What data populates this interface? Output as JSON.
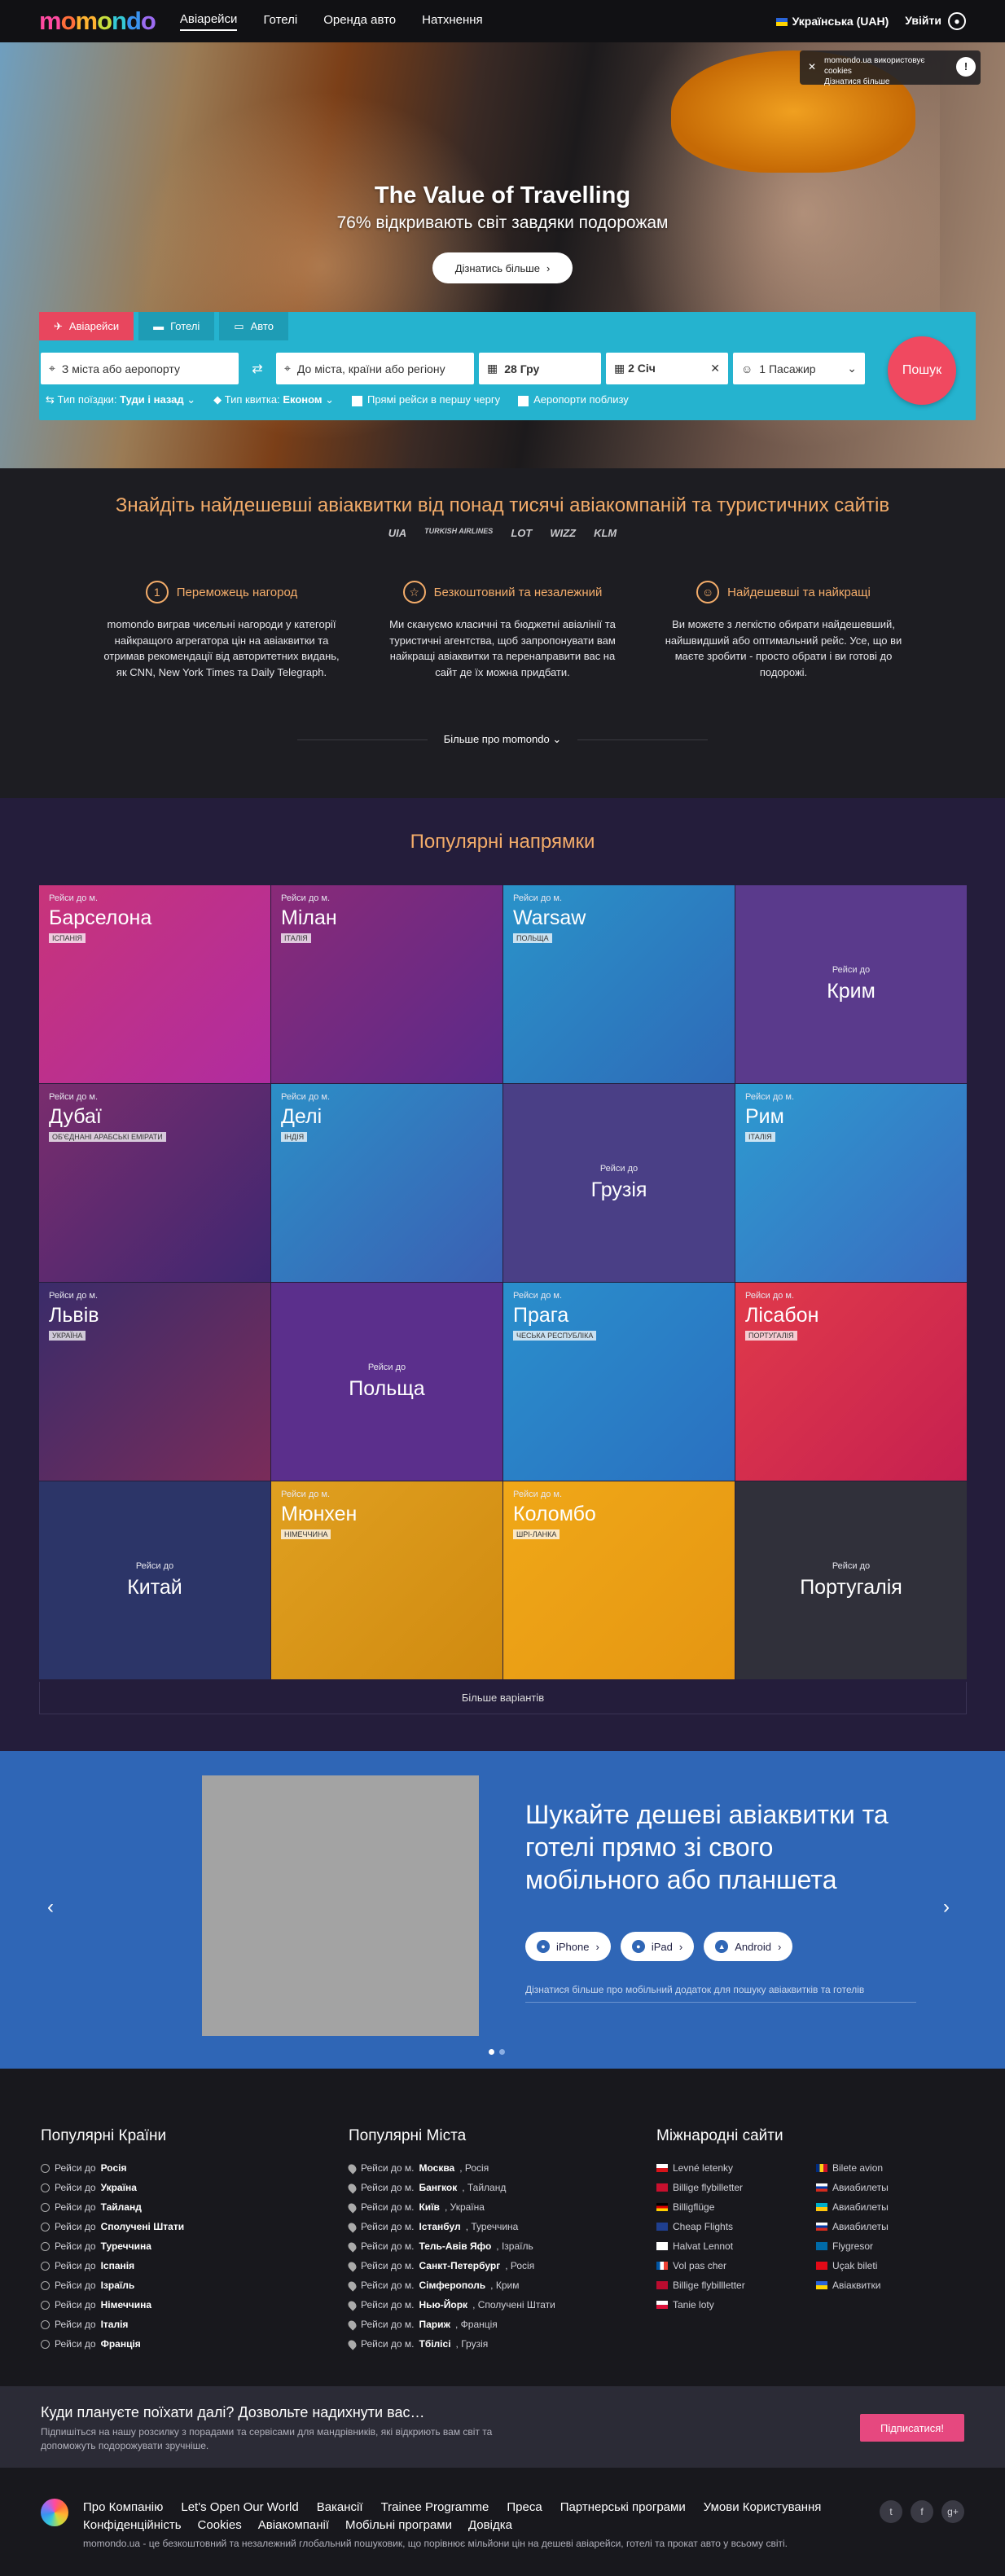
{
  "nav": {
    "logo": "momondo",
    "logo_letters": [
      "m",
      "o",
      "m",
      "o",
      "n",
      "d",
      "o"
    ],
    "links": [
      "Авіарейси",
      "Готелі",
      "Оренда авто",
      "Натхнення"
    ],
    "language": "Українська (UAH)",
    "login": "Увійти"
  },
  "hero": {
    "title": "The Value of Travelling",
    "subtitle": "76% відкривають світ завдяки подорожам",
    "button": "Дізнатись більше"
  },
  "cookie": {
    "text": "momondo.ua використовує cookies",
    "link": "Дізнатися більше"
  },
  "search": {
    "tabs": [
      "Авіарейси",
      "Готелі",
      "Авто"
    ],
    "from_placeholder": "З міста або аеропорту",
    "to_placeholder": "До міста, країни або регіону",
    "depart": "28 Гру",
    "return": "2 Січ",
    "passengers": "1 Пасажир",
    "button": "Пошук",
    "trip_type_label": "Тип поїздки:",
    "trip_type_value": "Туди і назад",
    "ticket_type_label": "Тип квитка:",
    "ticket_type_value": "Економ",
    "direct_first": "Прямі рейси в першу чергу",
    "nearby_airports": "Аеропорти поблизу"
  },
  "find": {
    "title": "Знайдіть найдешевші авіаквитки від понад тисячі авіакомпаній та туристичних сайтів",
    "airlines": [
      "UIA",
      "TURKISH AIRLINES",
      "LOT",
      "WIZZ",
      "KLM"
    ],
    "features": [
      {
        "title": "Переможець нагород",
        "text": "momondo виграв чисельні нагороди у категорії найкращого агрегатора цін на авіаквитки та отримав рекомендації від авторитетних видань, як CNN, New York Times та Daily Telegraph."
      },
      {
        "title": "Безкоштовний та незалежний",
        "text": "Ми скануємо класичні та бюджетні авіалінії та туристичні агентства, щоб запропонувати вам найкращі авіаквитки та перенаправити вас на сайт де їх можна придбати."
      },
      {
        "title": "Найдешевші та найкращі",
        "text": "Ви можете з легкістю обирати найдешевший, найшвидший або оптимальний рейс. Усе, що ви маєте зробити - просто обрати і ви готові до подорожі."
      }
    ],
    "more": "Більше про momondo"
  },
  "popular": {
    "title": "Популярні напрямки",
    "prefix_city": "Рейси до м.",
    "prefix_country": "Рейси до",
    "tiles": [
      {
        "city": "Барселона",
        "country": "Іспанія",
        "kind": "city",
        "bg": "linear-gradient(135deg,#c8347a,#b02ca0)"
      },
      {
        "city": "Мілан",
        "country": "Італія",
        "kind": "city",
        "bg": "linear-gradient(135deg,#8a2a78,#5b2a8a)"
      },
      {
        "city": "Warsaw",
        "country": "Польща",
        "kind": "city",
        "bg": "linear-gradient(135deg,#2a93c9,#2e6ab8)"
      },
      {
        "city": "Крим",
        "country": "",
        "kind": "country",
        "bg": "#5a3a8c"
      },
      {
        "city": "Дубаї",
        "country": "Об'єднані Арабські Емірати",
        "kind": "city",
        "bg": "linear-gradient(135deg,#7a2d6e,#3e2770)"
      },
      {
        "city": "Делі",
        "country": "Індія",
        "kind": "city",
        "bg": "linear-gradient(135deg,#2c8fc7,#3b5fb3)"
      },
      {
        "city": "Грузія",
        "country": "",
        "kind": "country",
        "bg": "#4a3f86"
      },
      {
        "city": "Рим",
        "country": "Італія",
        "kind": "city",
        "bg": "linear-gradient(135deg,#2d9ad0,#3a6cc0)"
      },
      {
        "city": "Львів",
        "country": "Україна",
        "kind": "city",
        "bg": "linear-gradient(135deg,#3a2c6a,#7a2c5a)"
      },
      {
        "city": "Польща",
        "country": "",
        "kind": "country",
        "bg": "#5b2f8c"
      },
      {
        "city": "Прага",
        "country": "Чеська Республіка",
        "kind": "city",
        "bg": "linear-gradient(135deg,#2a8fcc,#2a70c0)"
      },
      {
        "city": "Лісабон",
        "country": "Португалія",
        "kind": "city",
        "bg": "linear-gradient(135deg,#e03a4a,#c62050)"
      },
      {
        "city": "Китай",
        "country": "",
        "kind": "country",
        "bg": "#2c3568"
      },
      {
        "city": "Мюнхен",
        "country": "Німеччина",
        "kind": "city",
        "bg": "linear-gradient(135deg,#e0a020,#d08a10)"
      },
      {
        "city": "Коломбо",
        "country": "Шрі-Ланка",
        "kind": "city",
        "bg": "linear-gradient(135deg,#f0a818,#e59612)"
      },
      {
        "city": "Португалія",
        "country": "",
        "kind": "country",
        "bg": "#30303a"
      }
    ],
    "more": "Більше варіантів"
  },
  "promo": {
    "title": "Шукайте дешеві авіаквитки та готелі прямо зі свого мобільного або планшета",
    "stores": [
      "iPhone",
      "iPad",
      "Android"
    ],
    "more": "Дізнатися більше про мобільний додаток для пошуку авіаквитків та готелів"
  },
  "links": {
    "countries": {
      "title": "Популярні Країни",
      "prefix": "Рейси до",
      "items": [
        "Росія",
        "Україна",
        "Тайланд",
        "Сполучені Штати",
        "Туреччина",
        "Іспанія",
        "Ізраїль",
        "Німеччина",
        "Італія",
        "Франція"
      ]
    },
    "cities": {
      "title": "Популярні Міста",
      "prefix": "Рейси до м.",
      "items": [
        {
          "city": "Москва",
          "country": "Росія"
        },
        {
          "city": "Бангкок",
          "country": "Тайланд"
        },
        {
          "city": "Київ",
          "country": "Україна"
        },
        {
          "city": "Істанбул",
          "country": "Туреччина"
        },
        {
          "city": "Тель-Авів Яфо",
          "country": "Ізраїль"
        },
        {
          "city": "Санкт-Петербург",
          "country": "Росія"
        },
        {
          "city": "Сімферополь",
          "country": "Крим"
        },
        {
          "city": "Нью-Йорк",
          "country": "Сполучені Штати"
        },
        {
          "city": "Париж",
          "country": "Франція"
        },
        {
          "city": "Тбілісі",
          "country": "Грузія"
        }
      ]
    },
    "international": {
      "title": "Міжнародні сайти",
      "col1": [
        {
          "label": "Levné letenky",
          "flag": "linear-gradient(#fff 50%,#d7141a 50%)"
        },
        {
          "label": "Billige flybilletter",
          "flag": "#c8102e"
        },
        {
          "label": "Billigflüge",
          "flag": "linear-gradient(#000 33%,#dd0000 33%,#dd0000 66%,#ffce00 66%)"
        },
        {
          "label": "Cheap Flights",
          "flag": "#1f3f8f"
        },
        {
          "label": "Halvat Lennot",
          "flag": "#fff"
        },
        {
          "label": "Vol pas cher",
          "flag": "linear-gradient(90deg,#0055a4 33%,#fff 33%,#fff 66%,#ef4135 66%)"
        },
        {
          "label": "Billige flybillletter",
          "flag": "#ba0c2f"
        },
        {
          "label": "Tanie loty",
          "flag": "linear-gradient(#fff 50%,#dc143c 50%)"
        }
      ],
      "col2": [
        {
          "label": "Bilete avion",
          "flag": "linear-gradient(90deg,#002b7f 33%,#fcd116 33%,#fcd116 66%,#ce1126 66%)"
        },
        {
          "label": "Авиабилеты",
          "flag": "linear-gradient(#fff 33%,#0039a6 33%,#0039a6 66%,#d52b1e 66%)"
        },
        {
          "label": "Авиабилеты",
          "flag": "linear-gradient(#00afca 50%,#fec50c 50%)"
        },
        {
          "label": "Авиабилеты",
          "flag": "linear-gradient(#fff 33%,#0039a6 33%,#0039a6 66%,#d52b1e 66%)"
        },
        {
          "label": "Flygresor",
          "flag": "#006aa7"
        },
        {
          "label": "Uçak bileti",
          "flag": "#e30a17"
        },
        {
          "label": "Авіаквитки",
          "flag": "linear-gradient(#2a64d8 50%,#ffd400 50%)"
        }
      ]
    }
  },
  "newsletter": {
    "title": "Куди плануєте поїхати далі? Дозвольте надихнути вас…",
    "text": "Підпишіться на нашу розсилку з порадами та сервісами для мандрівників, які відкриють вам світ та допоможуть подорожувати зручніше.",
    "button": "Підписатися!"
  },
  "footer": {
    "links1": [
      "Про Компанію",
      "Let's Open Our World",
      "Вакансії",
      "Trainee Programme",
      "Преса",
      "Партнерські програми",
      "Умови Користування"
    ],
    "links2": [
      "Конфіденційність",
      "Cookies",
      "Авіакомпанії",
      "Мобільні програми",
      "Довідка"
    ],
    "legal": "momondo.ua - це безкоштовний та незалежний глобальний пошуковик, що порівнює мільйони цін на дешеві авіарейси, готелі та прокат авто у всьому світі.",
    "socials": [
      "twitter-icon",
      "facebook-icon",
      "googleplus-icon"
    ]
  }
}
